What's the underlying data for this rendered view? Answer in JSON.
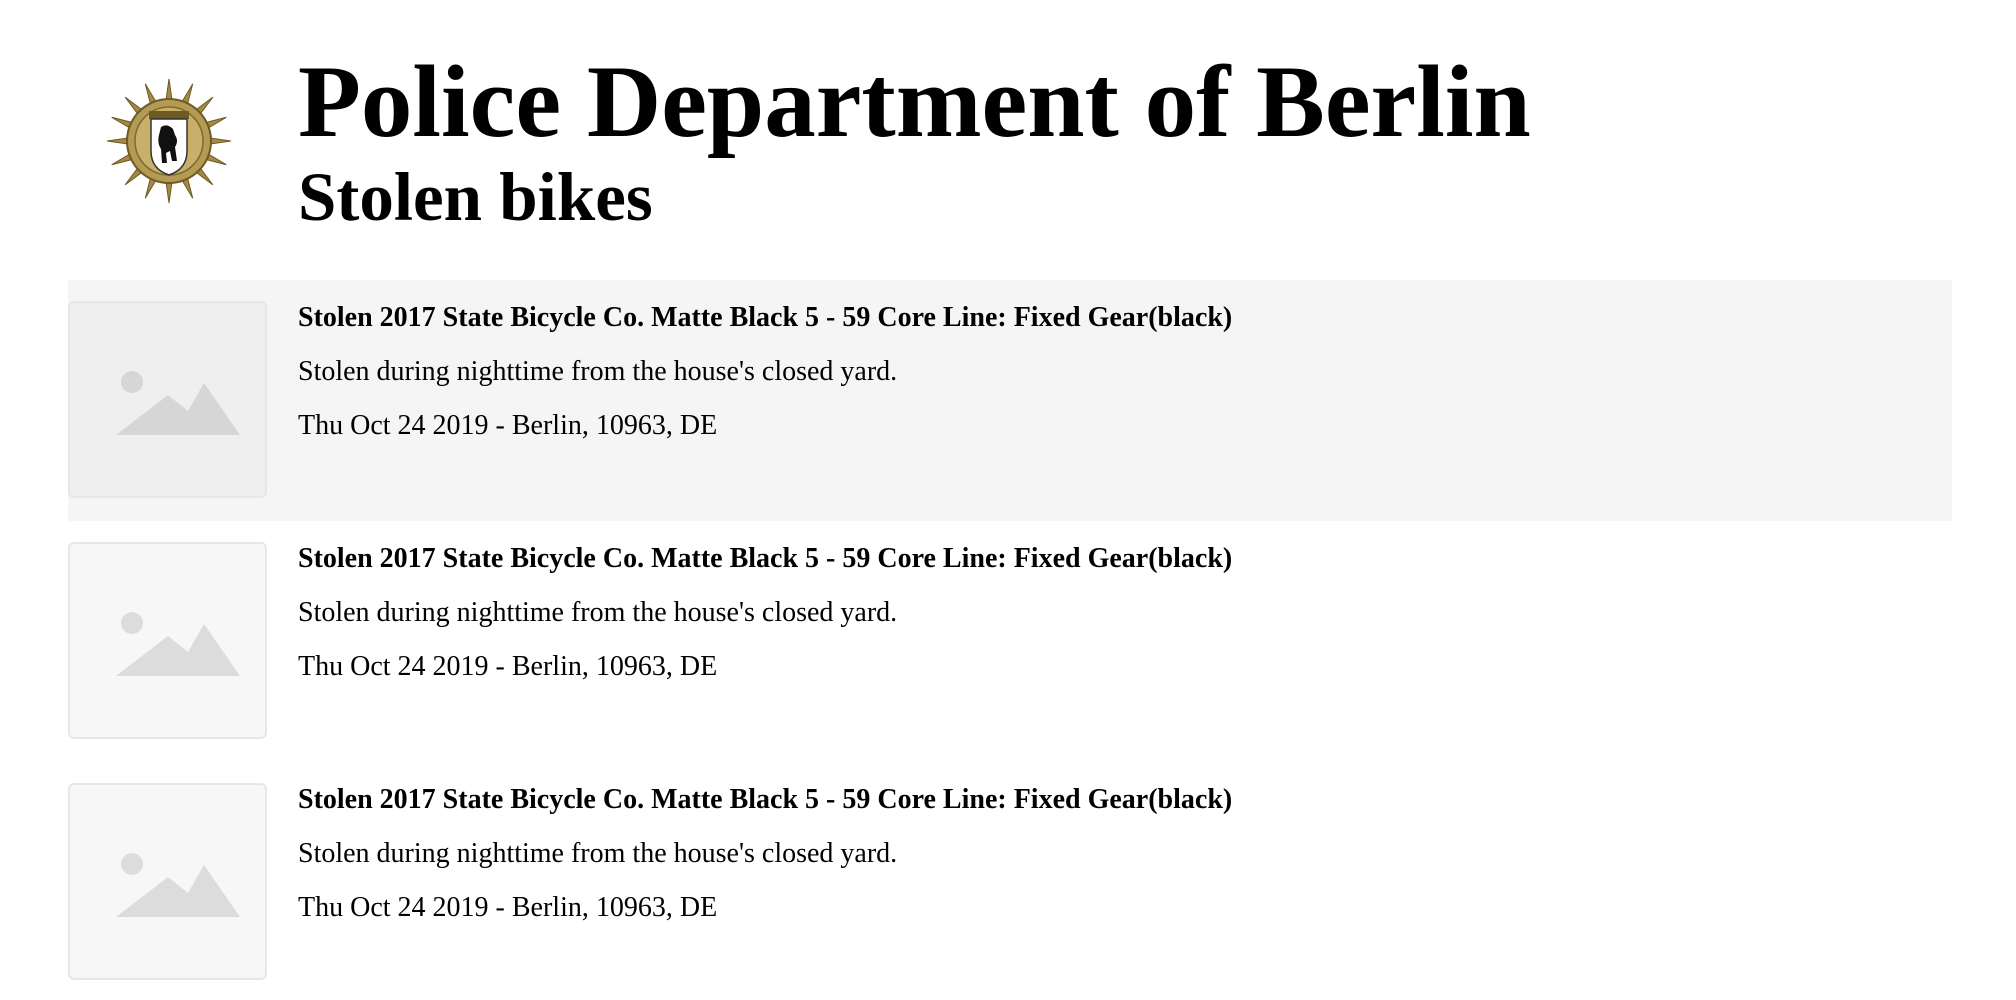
{
  "header": {
    "title": "Police Department of Berlin",
    "subtitle": "Stolen bikes",
    "logo_icon": "berlin-police-star-icon"
  },
  "colors": {
    "highlight_row": "#f5f5f5",
    "thumb_border": "#e7e7e7",
    "placeholder_icon": "#d9d9d9",
    "badge_gold": "#a38a45"
  },
  "list": {
    "items": [
      {
        "title": "Stolen 2017 State Bicycle Co. Matte Black 5 - 59 Core Line: Fixed Gear(black)",
        "description": "Stolen during nighttime from the house's closed yard.",
        "meta": "Thu Oct 24 2019 - Berlin, 10963, DE",
        "image_icon": "image-placeholder-icon",
        "highlighted": true
      },
      {
        "title": "Stolen 2017 State Bicycle Co. Matte Black 5 - 59 Core Line: Fixed Gear(black)",
        "description": "Stolen during nighttime from the house's closed yard.",
        "meta": "Thu Oct 24 2019 - Berlin, 10963, DE",
        "image_icon": "image-placeholder-icon",
        "highlighted": false
      },
      {
        "title": "Stolen 2017 State Bicycle Co. Matte Black 5 - 59 Core Line: Fixed Gear(black)",
        "description": "Stolen during nighttime from the house's closed yard.",
        "meta": "Thu Oct 24 2019 - Berlin, 10963, DE",
        "image_icon": "image-placeholder-icon",
        "highlighted": false
      }
    ]
  }
}
